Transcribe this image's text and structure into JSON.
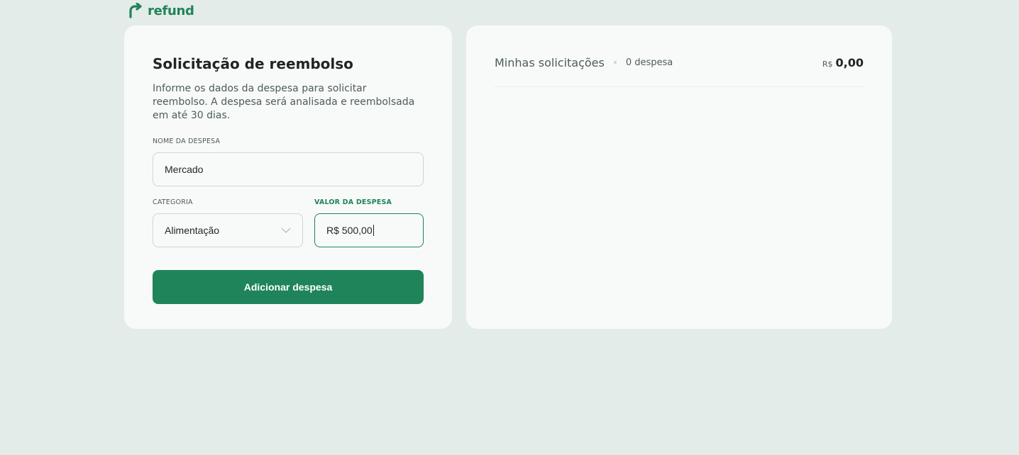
{
  "brand": {
    "name": "refund",
    "color": "#1f8459"
  },
  "form": {
    "title": "Solicitação de reembolso",
    "description": "Informe os dados da despesa para solicitar reembolso. A despesa será analisada e reembolsada em até 30 dias.",
    "name_label": "Nome da despesa",
    "name_value": "Mercado",
    "category_label": "Categoria",
    "category_value": "Alimentação",
    "amount_label": "Valor da despesa",
    "amount_value": "R$ 500,00",
    "submit_label": "Adicionar despesa"
  },
  "list": {
    "title": "Minhas solicitações",
    "count": "0 despesa",
    "currency": "R$",
    "total": "0,00"
  },
  "icons": {
    "logo": "refund-arrow-icon",
    "category_select": "chevron-down-icon"
  }
}
